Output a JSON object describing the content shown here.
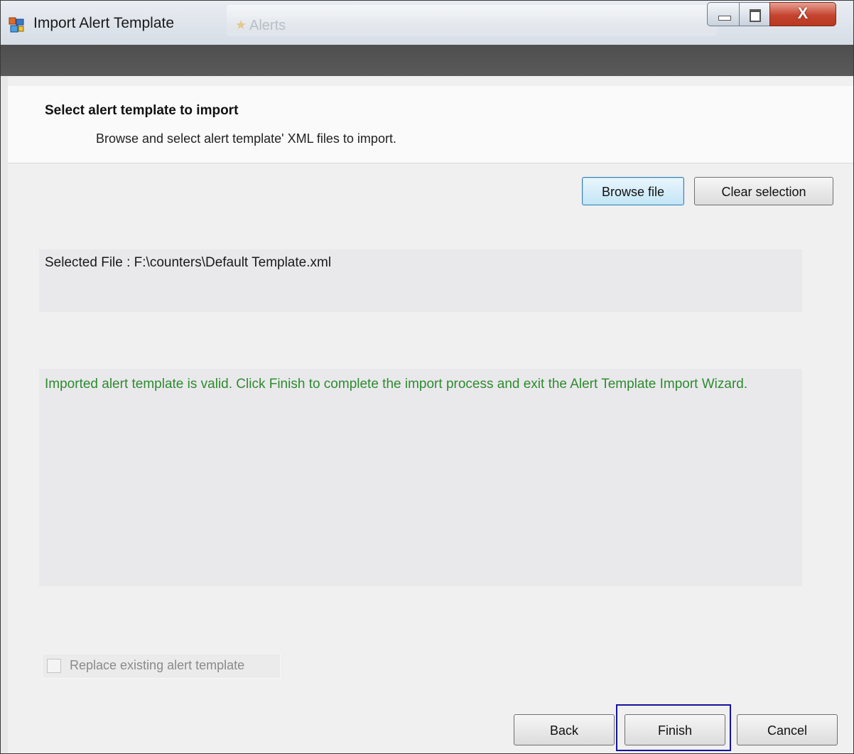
{
  "window": {
    "title": "Import Alert Template",
    "background_tab_label": "Alerts",
    "controls": {
      "minimize_icon": "minimize-icon",
      "maximize_icon": "maximize-icon",
      "close_glyph": "X"
    }
  },
  "header": {
    "title": "Select alert template to import",
    "subtitle": "Browse and select alert template' XML files to import."
  },
  "toolbar": {
    "browse_label": "Browse file",
    "clear_label": "Clear selection"
  },
  "selected_file": {
    "text": "Selected File : F:\\counters\\Default Template.xml"
  },
  "status": {
    "message": "Imported alert template is valid. Click Finish to complete the import process and exit the Alert Template Import Wizard.",
    "color": "#2e8b2e"
  },
  "options": {
    "replace_label": "Replace existing alert template",
    "replace_checked": false,
    "replace_enabled": false
  },
  "footer": {
    "back_label": "Back",
    "finish_label": "Finish",
    "cancel_label": "Cancel"
  }
}
